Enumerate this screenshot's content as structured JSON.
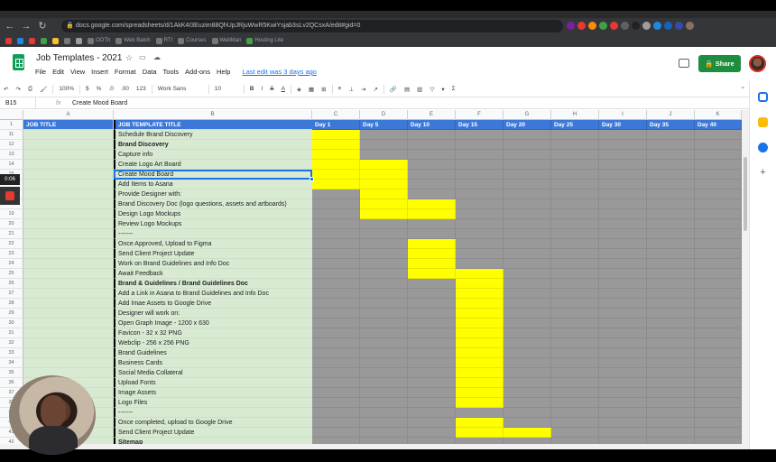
{
  "browser": {
    "url": "docs.google.com/spreadsheets/d/1AkK4I3Euzim88QhUpJRjuWwR5KwiYsjab3sLv2QCsxA/edit#gid=0",
    "bookmarks": [
      "OOTh",
      "Web Batch",
      "RTI",
      "Courses",
      "WebMan",
      "Hosting Lite"
    ]
  },
  "sheets": {
    "title": "Job Templates - 2021",
    "menu": [
      "File",
      "Edit",
      "View",
      "Insert",
      "Format",
      "Data",
      "Tools",
      "Add-ons",
      "Help"
    ],
    "last_edit": "Last edit was 3 days ago",
    "share_label": "Share",
    "toolbar": {
      "zoom": "100%",
      "currency": "$",
      "percent": "%",
      "decimal_less": ".0",
      "decimal_more": ".00",
      "format_more": "123",
      "font": "Work Sans",
      "font_size": "10",
      "bold": "B",
      "italic": "I",
      "strike": "S",
      "text_color": "A"
    },
    "formula_bar": {
      "cell_ref": "B15",
      "fx": "fx",
      "value": "Create Mood Board"
    },
    "column_letters": [
      "A",
      "B",
      "C",
      "D",
      "E",
      "F",
      "G",
      "H",
      "I",
      "J",
      "K"
    ],
    "header_row": {
      "row_number": "1",
      "col_a": "JOB TITLE",
      "col_b": "JOB TEMPLATE TITLE",
      "days": [
        "Day 1",
        "Day 5",
        "Day 10",
        "Day 15",
        "Day 20",
        "Day 25",
        "Day 30",
        "Day 35",
        "Day 40"
      ]
    },
    "rows": [
      {
        "n": "11",
        "text": "Schedule Brand Discovery",
        "bold": false,
        "yellow": [
          0
        ]
      },
      {
        "n": "12",
        "text": "Brand Discovery",
        "bold": true,
        "yellow": [
          0
        ]
      },
      {
        "n": "13",
        "text": "Capture info",
        "bold": false,
        "yellow": [
          0
        ]
      },
      {
        "n": "14",
        "text": "Create Logo Art Board",
        "bold": false,
        "yellow": [
          0,
          1
        ]
      },
      {
        "n": "15",
        "text": "Create Mood Board",
        "bold": false,
        "yellow": [
          0,
          1
        ]
      },
      {
        "n": "16",
        "text": "Add Items to Asana",
        "bold": false,
        "yellow": [
          0,
          1
        ]
      },
      {
        "n": "17",
        "text": "Provide Designer with:",
        "bold": false,
        "yellow": [
          1
        ]
      },
      {
        "n": "18",
        "text": "Brand Discovery Doc (logo questions, assets and artboards)",
        "bold": false,
        "yellow": [
          1,
          2
        ]
      },
      {
        "n": "19",
        "text": "Design Logo Mockups",
        "bold": false,
        "yellow": [
          1,
          2
        ]
      },
      {
        "n": "20",
        "text": "Review Logo Mockups",
        "bold": false,
        "yellow": []
      },
      {
        "n": "21",
        "text": "-------",
        "bold": false,
        "yellow": []
      },
      {
        "n": "22",
        "text": "Once Approved, Upload to Figma",
        "bold": false,
        "yellow": [
          2
        ]
      },
      {
        "n": "23",
        "text": "Send Client Project Update",
        "bold": false,
        "yellow": [
          2
        ]
      },
      {
        "n": "24",
        "text": "Work on Brand Guidelines and Info Doc",
        "bold": false,
        "yellow": [
          2
        ]
      },
      {
        "n": "25",
        "text": "Await Feedback",
        "bold": false,
        "yellow": [
          2,
          3
        ]
      },
      {
        "n": "26",
        "text": "Brand & Guidelines / Brand Guidelines Doc",
        "bold": true,
        "yellow": [
          3
        ]
      },
      {
        "n": "27",
        "text": "Add a Link in Asana to Brand Guidelines and Info Doc",
        "bold": false,
        "yellow": [
          3
        ]
      },
      {
        "n": "28",
        "text": "Add Imae Assets to Google Drive",
        "bold": false,
        "yellow": [
          3
        ]
      },
      {
        "n": "29",
        "text": "Designer will work on:",
        "bold": false,
        "yellow": [
          3
        ]
      },
      {
        "n": "30",
        "text": "Open Graph Image - 1200 x 630",
        "bold": false,
        "yellow": [
          3
        ]
      },
      {
        "n": "31",
        "text": "Favicon - 32 x 32 PNG",
        "bold": false,
        "yellow": [
          3
        ]
      },
      {
        "n": "32",
        "text": "Webclip - 256 x 256 PNG",
        "bold": false,
        "yellow": [
          3
        ]
      },
      {
        "n": "33",
        "text": "Brand Guidelines",
        "bold": false,
        "yellow": [
          3
        ]
      },
      {
        "n": "34",
        "text": "Business Cards",
        "bold": false,
        "yellow": [
          3
        ]
      },
      {
        "n": "35",
        "text": "Social Media Collateral",
        "bold": false,
        "yellow": [
          3
        ]
      },
      {
        "n": "36",
        "text": "Upload Fonts",
        "bold": false,
        "yellow": [
          3
        ]
      },
      {
        "n": "37",
        "text": "Image Assets",
        "bold": false,
        "yellow": [
          3
        ]
      },
      {
        "n": "38",
        "text": "Logo Files",
        "bold": false,
        "yellow": [
          3
        ]
      },
      {
        "n": "39",
        "text": "-------",
        "bold": false,
        "yellow": []
      },
      {
        "n": "40",
        "text": "Once completed, upload to Google Drive",
        "bold": false,
        "yellow": [
          3
        ]
      },
      {
        "n": "41",
        "text": "Send Client Project Update",
        "bold": false,
        "yellow": [
          3,
          4
        ]
      },
      {
        "n": "42",
        "text": "Sitemap",
        "bold": true,
        "yellow": []
      }
    ]
  },
  "overlay": {
    "timer": "0:06"
  },
  "colors": {
    "header_blue": "#3c78d8",
    "light_green": "#d9ead3",
    "gantt_gray": "#999999",
    "gantt_yellow": "#ffff00",
    "share_green": "#1e8e3e"
  }
}
